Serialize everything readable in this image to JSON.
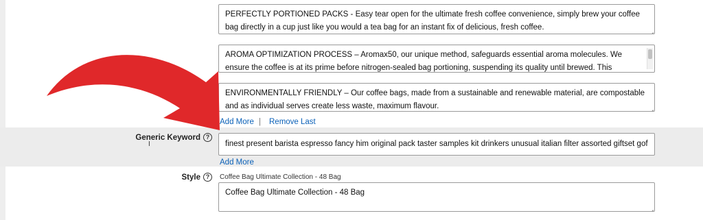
{
  "bullets": [
    "PERFECTLY PORTIONED PACKS - Easy tear open for the ultimate fresh coffee convenience, simply brew your coffee bag directly in a cup just like you would a tea bag for an instant fix of delicious, fresh coffee.",
    "AROMA OPTIMIZATION PROCESS – Aromax50, our unique method, safeguards essential aroma molecules. We ensure the coffee is at its prime before nitrogen-sealed bag portioning, suspending its quality until brewed. This process maximises aroma for delicious cups of coffee.",
    "ENVIRONMENTALLY FRIENDLY – Our coffee bags, made from a sustainable and renewable material, are compostable and as individual serves create less waste, maximum flavour."
  ],
  "bullet_actions": {
    "add_more": "Add More",
    "separator": "|",
    "remove_last": "Remove Last"
  },
  "generic_keyword": {
    "label": "Generic Keyword",
    "help": "?",
    "value": "finest present barista espresso fancy him original pack taster samples kit drinkers unusual italian filter assorted giftset gofts day m",
    "add_more": "Add More"
  },
  "style": {
    "label": "Style",
    "help": "?",
    "current": "Coffee Bag Ultimate Collection - 48 Bag",
    "value": "Coffee Bag Ultimate Collection - 48 Bag"
  },
  "cursor_glyph": "I",
  "colors": {
    "link": "#0b61b8",
    "arrow": "#e0282a",
    "band": "#ececec"
  }
}
